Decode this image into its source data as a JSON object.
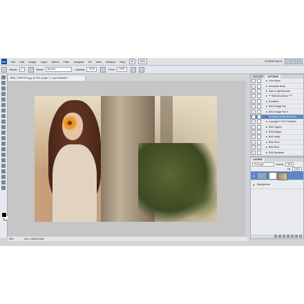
{
  "menubar": {
    "app_icon": "Ps",
    "items": [
      "File",
      "Edit",
      "Image",
      "Layer",
      "Select",
      "Filter",
      "Analysis",
      "3D",
      "View",
      "Window",
      "Help"
    ],
    "zoom": "50%",
    "workspace": "ESSENTIALS"
  },
  "options": {
    "brush_label": "Brush:",
    "brush_size": "9",
    "mode_label": "Mode:",
    "mode_value": "Normal",
    "opacity_label": "Opacity:",
    "opacity_value": "100%",
    "flow_label": "Flow:",
    "flow_value": "100%"
  },
  "document": {
    "tab_title": "BBB_7939THST.jpg @ 50% (Layer 1, Layer Mask/8) *",
    "status_zoom": "50%",
    "status_doc": "Doc: 4.60M/9.80M"
  },
  "actions_panel": {
    "tabs": [
      "HISTORY",
      "ACTIONS"
    ],
    "items": [
      {
        "label": "Color Brush",
        "selected": false
      },
      {
        "label": "Neutralize Brush",
        "selected": false
      },
      {
        "label": "Dark & Light Brushes",
        "selected": false
      },
      {
        "label": "*** BONUS Actions ****",
        "selected": false
      },
      {
        "label": "Emulation",
        "selected": false
      },
      {
        "label": "B/W Vintage Film",
        "selected": false
      },
      {
        "label": "B/W Vintage Film II",
        "selected": false
      },
      {
        "label": "Pixelbells Deluxe B/W Acti...",
        "selected": true
      },
      {
        "label": "Copyright © 2010 Pixelbell...",
        "selected": false
      },
      {
        "label": "B/W Organic",
        "selected": false
      },
      {
        "label": "B/W Antique",
        "selected": false
      },
      {
        "label": "B/W Vanity",
        "selected": false
      },
      {
        "label": "B/W Film II",
        "selected": false
      },
      {
        "label": "B/W Mood",
        "selected": false
      },
      {
        "label": "B/W Sepiatone",
        "selected": false
      }
    ]
  },
  "layers_panel": {
    "tabs": [
      "LAYERS"
    ],
    "blend_mode": "Soft Light",
    "opacity_label": "Opacity:",
    "opacity_value": "30%",
    "fill_label": "Fill:",
    "fill_value": "100%",
    "layers": [
      {
        "name": "Layer 1",
        "selected": true,
        "thumb": "blue"
      },
      {
        "name": "Background",
        "selected": false,
        "thumb": "photo"
      }
    ]
  }
}
